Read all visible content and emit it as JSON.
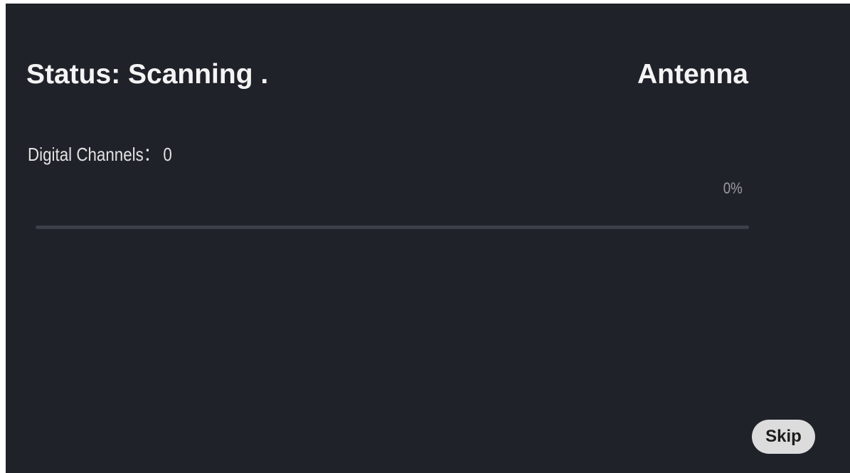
{
  "status": {
    "text": "Status: Scanning ."
  },
  "source": {
    "label": "Antenna"
  },
  "channels": {
    "label": "Digital Channels：",
    "count": "0"
  },
  "progress": {
    "percent_text": "0%",
    "value": 0
  },
  "actions": {
    "skip_label": "Skip"
  },
  "colors": {
    "background": "#20222a",
    "track": "#3c3f47",
    "button": "#dcdcdc"
  }
}
